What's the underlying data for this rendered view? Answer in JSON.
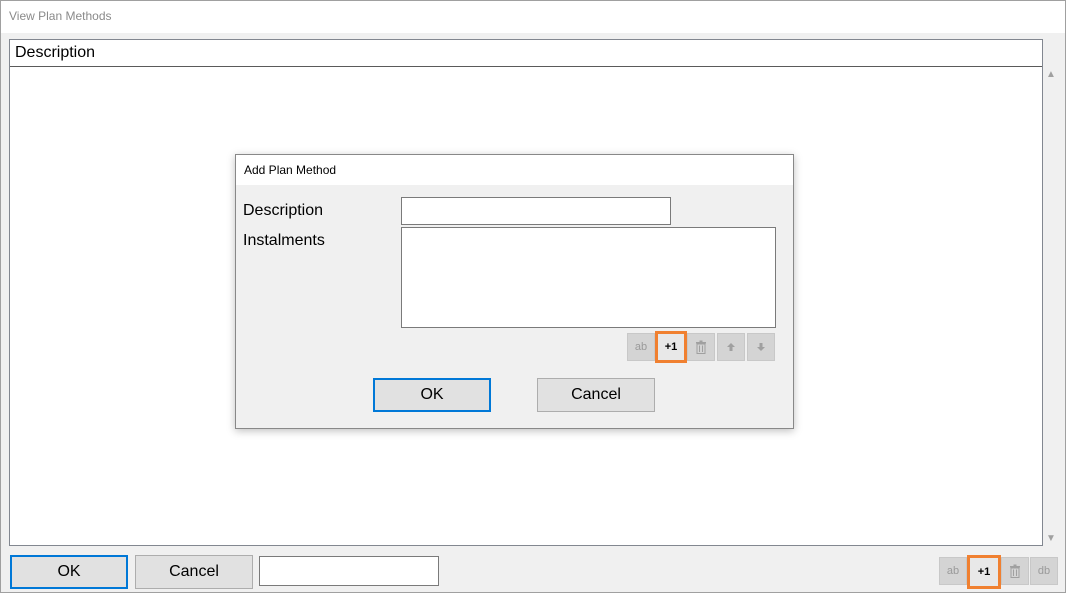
{
  "window": {
    "title": "View Plan Methods"
  },
  "list": {
    "column_header": "Description"
  },
  "footer": {
    "ok_label": "OK",
    "cancel_label": "Cancel",
    "text_value": "",
    "toolbar": {
      "edit_icon_label": "ab",
      "add_label": "+1",
      "db_label": "db"
    }
  },
  "dialog": {
    "title": "Add Plan Method",
    "description_label": "Description",
    "description_value": "",
    "instalments_label": "Instalments",
    "ok_label": "OK",
    "cancel_label": "Cancel",
    "toolbar": {
      "edit_icon_label": "ab",
      "add_label": "+1"
    }
  },
  "colors": {
    "highlight": "#f08030",
    "default_button_border": "#0078d7"
  }
}
